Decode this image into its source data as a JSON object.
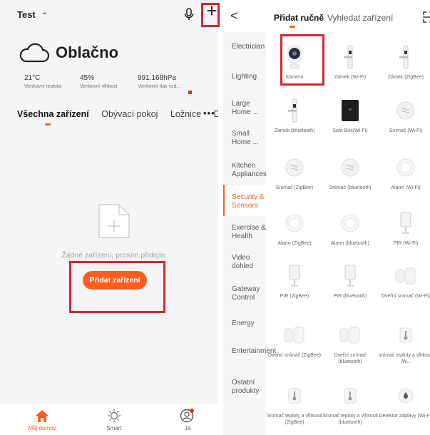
{
  "left": {
    "home_name": "Test",
    "weather": {
      "condition": "Oblačno"
    },
    "stats": [
      {
        "value": "21°C",
        "label": "Venkovní teplota"
      },
      {
        "value": "45%",
        "label": "Venkovní vlhkost"
      },
      {
        "value": "991.168hPa",
        "label": "Venkovní tlak vzd..."
      }
    ],
    "room_tabs": [
      "Všechna zařízení",
      "Obývací pokoj",
      "Ložnice",
      "D"
    ],
    "tabs_more": "•••",
    "empty_text": "Žádné zařízení, prosím přidejte",
    "add_button": "Přidat zařízení",
    "bottom_nav": [
      {
        "label": "Můj domov",
        "icon": "home-icon"
      },
      {
        "label": "Smart",
        "icon": "sun-icon"
      },
      {
        "label": "Já",
        "icon": "profile-icon"
      }
    ]
  },
  "right": {
    "tabs": [
      "Přidat ručně",
      "Vyhledat zařízení"
    ],
    "categories": [
      "Electrician",
      "Lighting",
      "Large Home ...",
      "Small Home ...",
      "Kitchen Appliances",
      "Security & Sensors",
      "Exercise & Health",
      "Video dohled",
      "Gateway Control",
      "Energy",
      "Entertainment",
      "Ostatní produkty"
    ],
    "active_category": "Security & Sensors",
    "devices": [
      {
        "name": "Kamera",
        "icon": "camera-icon"
      },
      {
        "name": "Zámek (Wi-Fi)",
        "icon": "lock-icon"
      },
      {
        "name": "Zámek (ZigBee)",
        "icon": "lock-icon"
      },
      {
        "name": "Zámek (bluetooth)",
        "icon": "lock-icon"
      },
      {
        "name": "Safe Box(Wi-Fi)",
        "icon": "safe-icon"
      },
      {
        "name": "Snímač (Wi-Fi)",
        "icon": "sensor-icon"
      },
      {
        "name": "Snímač (ZigBee)",
        "icon": "sensor-icon"
      },
      {
        "name": "Snímač (bluetooth)",
        "icon": "sensor-icon"
      },
      {
        "name": "Alarm (Wi-Fi)",
        "icon": "alarm-icon"
      },
      {
        "name": "Alarm (ZigBee)",
        "icon": "alarm-icon"
      },
      {
        "name": "Alarm (bluetooth)",
        "icon": "alarm-icon"
      },
      {
        "name": "PIR (Wi-Fi)",
        "icon": "pir-icon"
      },
      {
        "name": "PIR (ZigBee)",
        "icon": "pir-icon"
      },
      {
        "name": "PIR (bluetooth)",
        "icon": "pir-icon"
      },
      {
        "name": "Dveřní snímač (Wi-Fi)",
        "icon": "door-sensor-icon"
      },
      {
        "name": "Dveřní snímač (ZigBee)",
        "icon": "door-sensor-icon"
      },
      {
        "name": "Dveřní snímač (bluetooth)",
        "icon": "door-sensor-icon"
      },
      {
        "name": "snímač teploty a vlhkosti (W...",
        "icon": "thermometer-icon"
      },
      {
        "name": "Snímač teploty a vlhkosti (ZigBee)",
        "icon": "thermometer-icon"
      },
      {
        "name": "Snímač teploty a vlhkosti (bluetooth)",
        "icon": "thermometer-icon"
      },
      {
        "name": "Detektor záplavy (Wi-Fi)",
        "icon": "water-leak-icon"
      }
    ]
  },
  "colors": {
    "accent": "#ff5d1f",
    "highlight_box": "#d7252d"
  }
}
